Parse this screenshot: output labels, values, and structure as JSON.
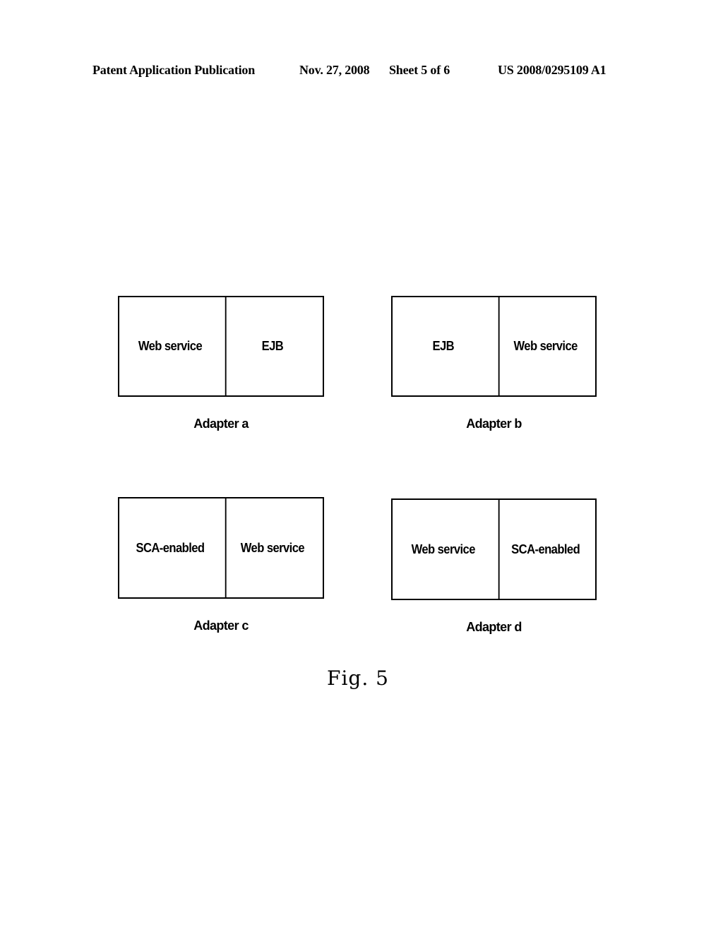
{
  "header": {
    "publication_type": "Patent Application Publication",
    "date": "Nov. 27, 2008",
    "sheet": "Sheet 5 of 6",
    "publication_number": "US 2008/0295109 A1"
  },
  "adapters": [
    {
      "caption": "Adapter a",
      "left": "Web service",
      "right": "EJB"
    },
    {
      "caption": "Adapter b",
      "left": "EJB",
      "right": "Web service"
    },
    {
      "caption": "Adapter c",
      "left": "SCA-enabled",
      "right": "Web service"
    },
    {
      "caption": "Adapter d",
      "left": "Web service",
      "right": "SCA-enabled"
    }
  ],
  "figure": {
    "label": "Fig. 5"
  }
}
